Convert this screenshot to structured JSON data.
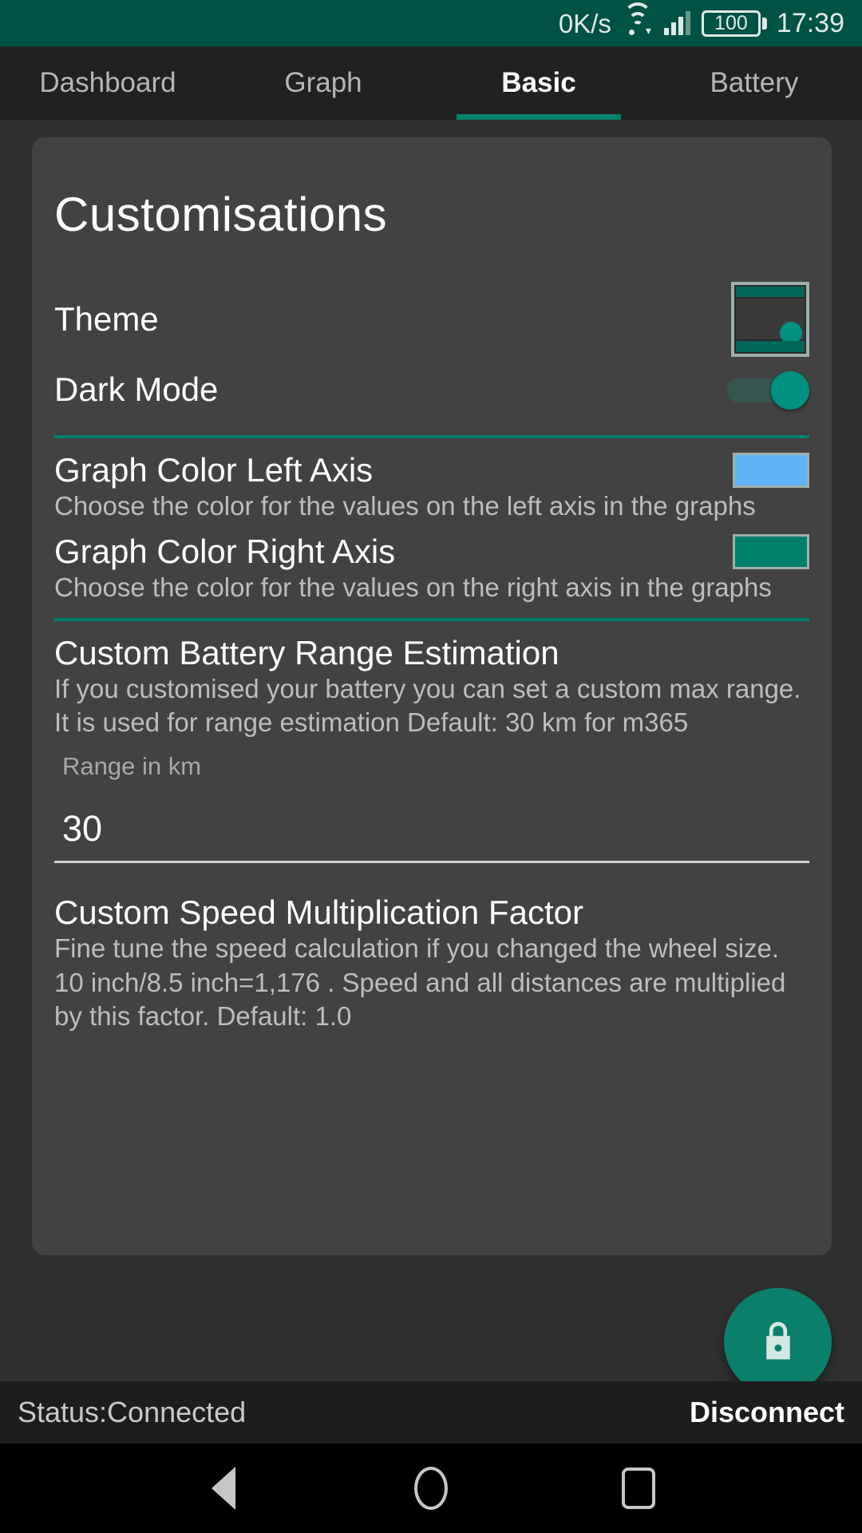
{
  "status_bar": {
    "network_speed": "0K/s",
    "wifi_icon": "wifi-icon",
    "signal_icon": "cellular-signal-icon",
    "battery_level": "100",
    "clock": "17:39"
  },
  "tabs": [
    {
      "label": "Dashboard",
      "active": false
    },
    {
      "label": "Graph",
      "active": false
    },
    {
      "label": "Basic",
      "active": true
    },
    {
      "label": "Battery",
      "active": false
    }
  ],
  "card": {
    "title": "Customisations",
    "theme": {
      "label": "Theme",
      "preview_icon": "theme-preview-icon"
    },
    "dark_mode": {
      "label": "Dark Mode",
      "state": "on"
    },
    "graph_color_left": {
      "label": "Graph Color Left Axis",
      "description": "Choose the color for the values on the left axis in the graphs",
      "color": "#5FB4F7"
    },
    "graph_color_right": {
      "label": "Graph Color Right Axis",
      "description": "Choose the color for the values on the right axis in the graphs",
      "color": "#00806A"
    },
    "battery_range": {
      "label": "Custom Battery Range Estimation",
      "description": "If you customised your battery you can set a custom max range. It is used for range estimation Default: 30 km for m365",
      "field_label": "Range in km",
      "value": "30",
      "placeholder": "Range in km"
    },
    "speed_factor": {
      "label": "Custom Speed Multiplication Factor",
      "description": "Fine tune the speed calculation if you changed the wheel size. 10 inch/8.5 inch=1,176 . Speed and all distances are multiplied by this factor. Default: 1.0"
    }
  },
  "fab": {
    "icon": "lock-icon",
    "color": "#0A806C"
  },
  "bottom_bar": {
    "status": "Status:Connected",
    "action": "Disconnect"
  },
  "nav_bar": {
    "back": "back-icon",
    "home": "home-icon",
    "recents": "recents-icon"
  },
  "theme_colors": {
    "accent": "#00806A",
    "status_bar": "#005244",
    "page_background": "#303030",
    "card_background": "#424242"
  }
}
